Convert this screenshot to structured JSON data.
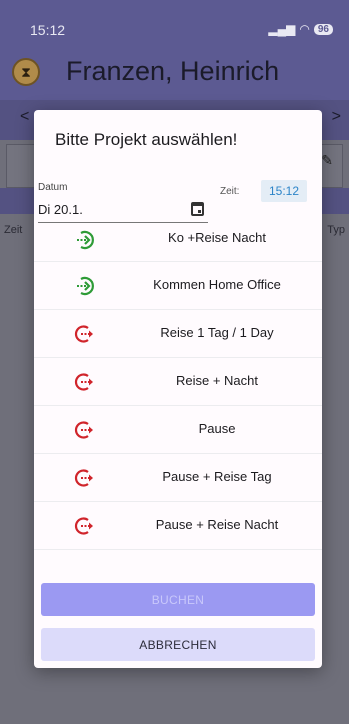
{
  "status": {
    "time": "15:12",
    "battery": "96"
  },
  "header": {
    "name": "Franzen, Heinrich",
    "nav_left": "<",
    "nav_right": ">"
  },
  "columns": {
    "left": "Zeit",
    "right": "Typ"
  },
  "dialog": {
    "title": "Bitte Projekt auswählen!",
    "date": {
      "label": "Datum",
      "value": "Di 20.1."
    },
    "time": {
      "label": "Zeit:",
      "value": "15:12"
    },
    "items": [
      {
        "label": "Ko +Reise Nacht",
        "icon": "login-icon",
        "color": "#2e9b37"
      },
      {
        "label": "Kommen Home Office",
        "icon": "login-icon",
        "color": "#2e9b37"
      },
      {
        "label": "Reise 1 Tag / 1 Day",
        "icon": "logout-icon",
        "color": "#d0242b"
      },
      {
        "label": "Reise + Nacht",
        "icon": "logout-icon",
        "color": "#d0242b"
      },
      {
        "label": "Pause",
        "icon": "logout-icon",
        "color": "#d0242b"
      },
      {
        "label": "Pause + Reise Tag",
        "icon": "logout-icon",
        "color": "#d0242b"
      },
      {
        "label": "Pause + Reise Nacht",
        "icon": "logout-icon",
        "color": "#d0242b"
      }
    ],
    "book_label": "BUCHEN",
    "cancel_label": "ABBRECHEN"
  }
}
